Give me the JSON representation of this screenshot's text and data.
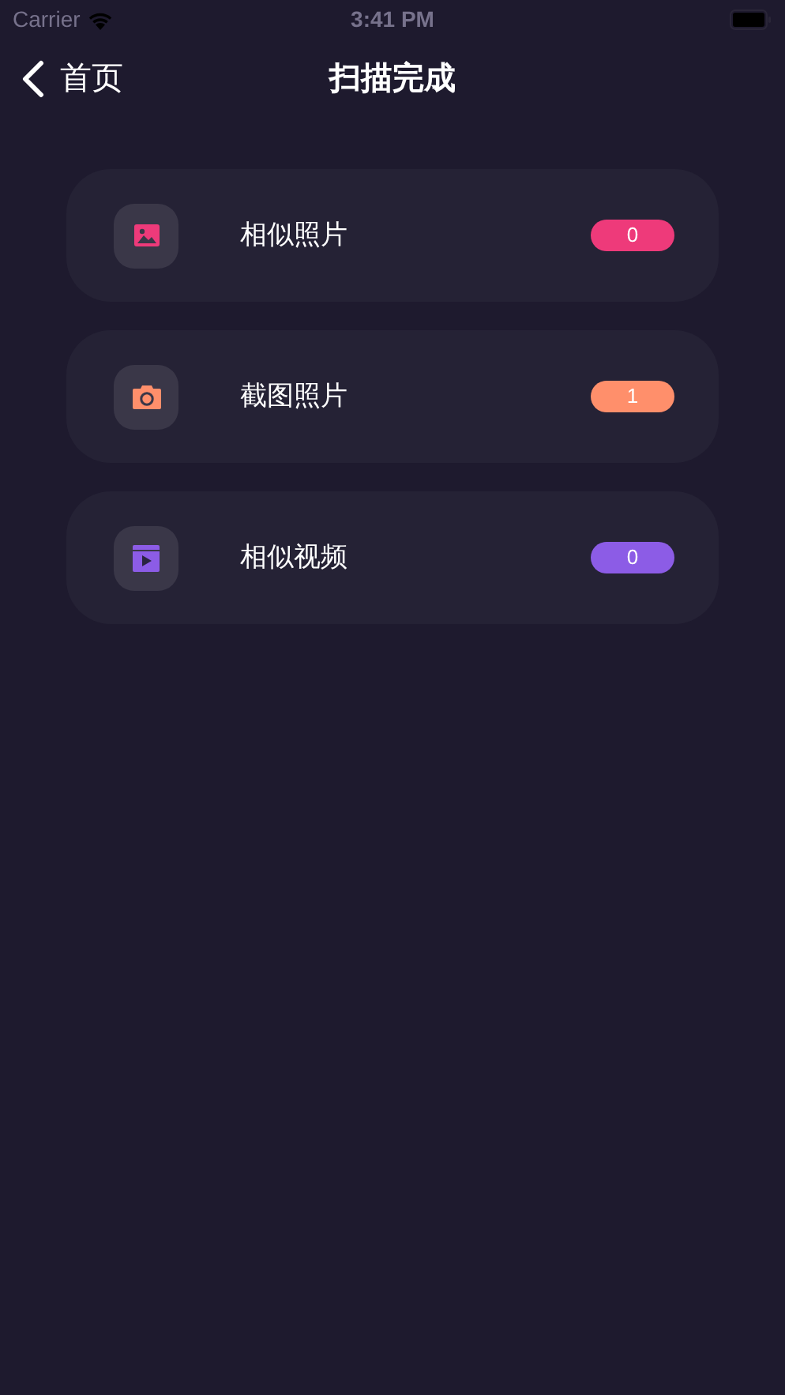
{
  "status_bar": {
    "carrier": "Carrier",
    "time": "3:41 PM"
  },
  "nav": {
    "back_label": "首页",
    "title": "扫描完成"
  },
  "items": [
    {
      "kind": "image",
      "label": "相似照片",
      "count": "0",
      "color": "#ee3a7a"
    },
    {
      "kind": "camera",
      "label": "截图照片",
      "count": "1",
      "color": "#ff8f6b"
    },
    {
      "kind": "video",
      "label": "相似视频",
      "count": "0",
      "color": "#8c5ce6"
    }
  ]
}
